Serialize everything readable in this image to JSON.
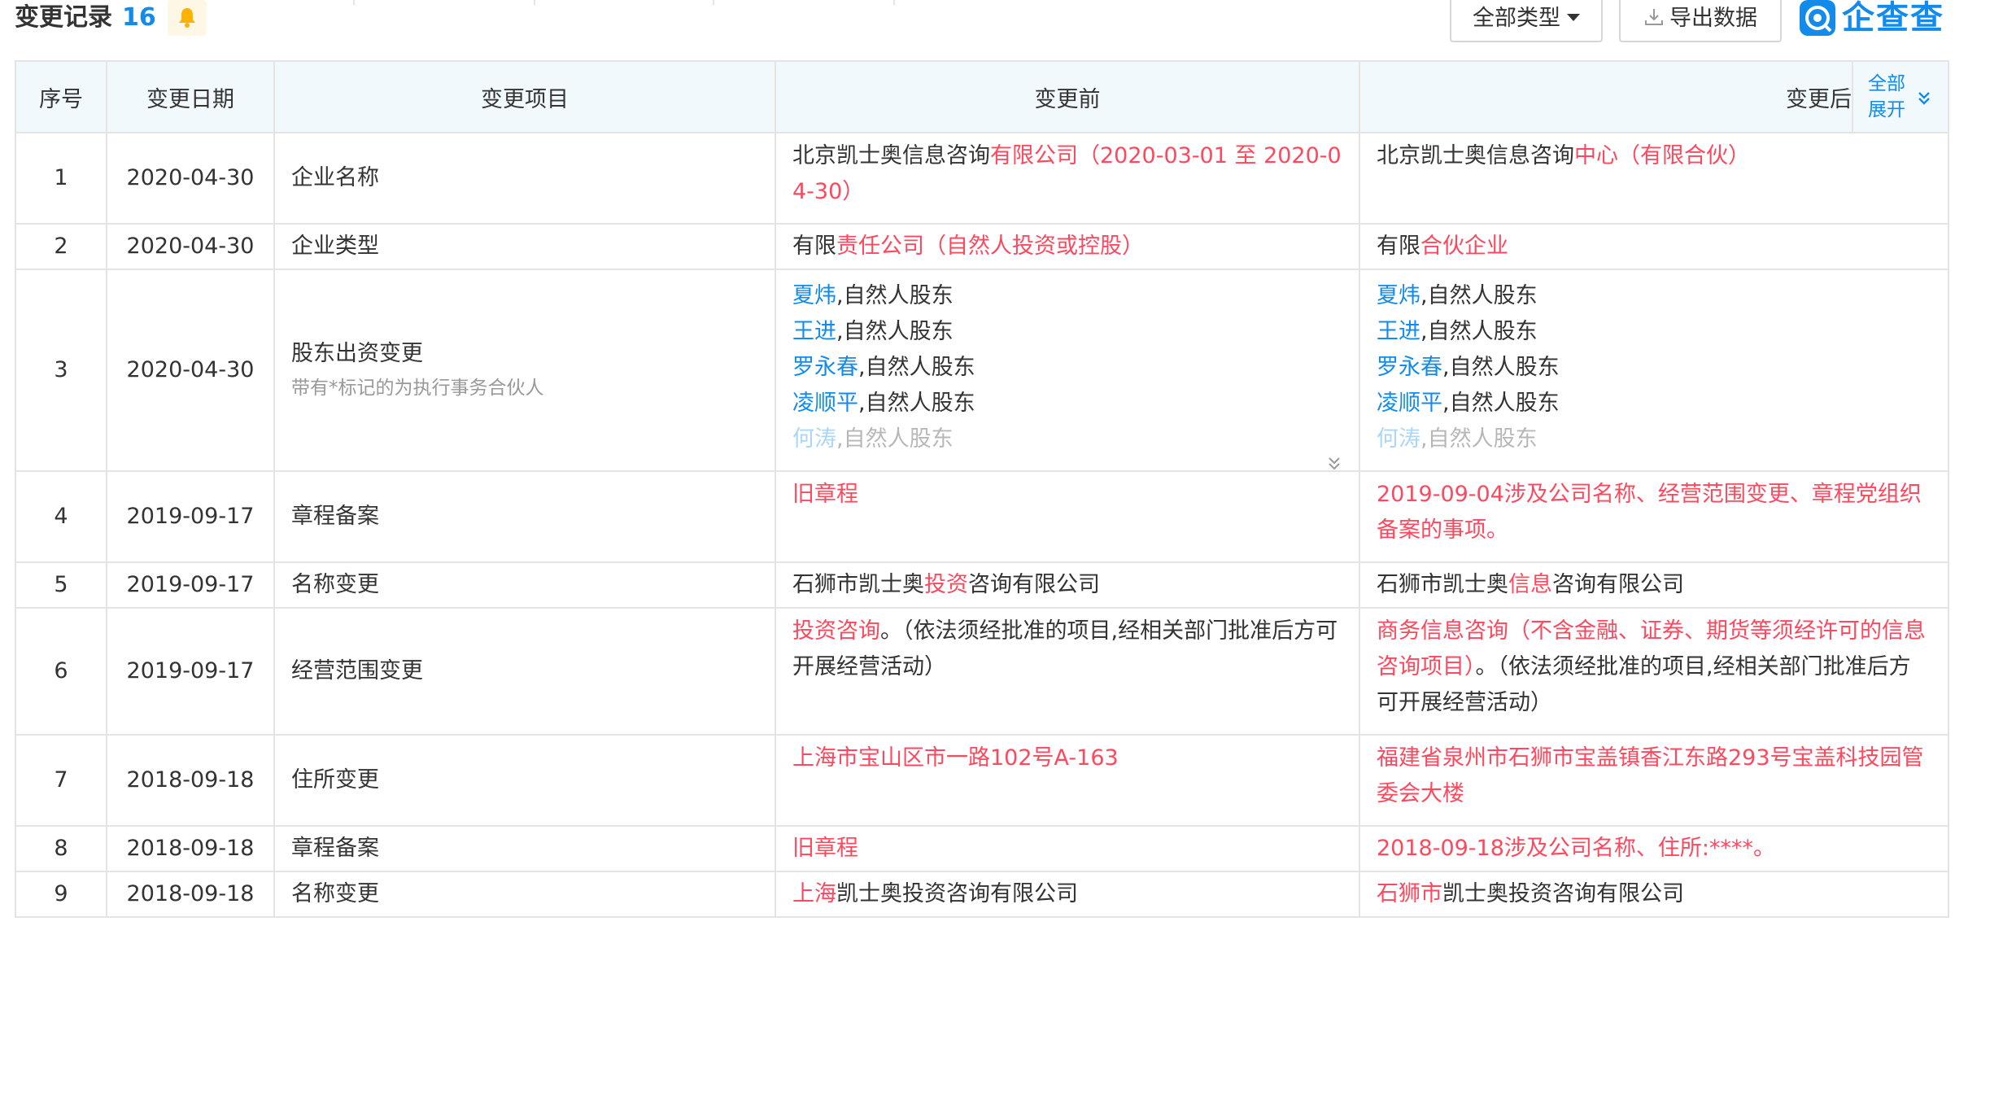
{
  "header": {
    "title": "变更记录",
    "count": "16",
    "type_filter_label": "全部类型",
    "export_label": "导出数据",
    "logo_text": "企查查",
    "accent_color": "#128bed",
    "highlight_color": "#fd485e"
  },
  "table": {
    "columns": [
      "序号",
      "变更日期",
      "变更项目",
      "变更前",
      "变更后"
    ],
    "expand_all_line1": "全部",
    "expand_all_line2": "展开",
    "rows": [
      {
        "no": "1",
        "date": "2020-04-30",
        "item": "企业名称",
        "before": [
          {
            "t": "北京凯士奥信息咨询"
          },
          {
            "t": "有限公司（2020-03-01 至 2020-04-30）",
            "hl": true
          }
        ],
        "after": [
          {
            "t": "北京凯士奥信息咨询"
          },
          {
            "t": "中心（有限合伙）",
            "hl": true
          }
        ]
      },
      {
        "no": "2",
        "date": "2020-04-30",
        "item": "企业类型",
        "before": [
          {
            "t": "有限"
          },
          {
            "t": "责任公司（自然人投资或控股）",
            "hl": true
          }
        ],
        "after": [
          {
            "t": "有限"
          },
          {
            "t": "合伙企业",
            "hl": true
          }
        ]
      },
      {
        "no": "3",
        "date": "2020-04-30",
        "item": "股东出资变更",
        "item_note": "带有*标记的为执行事务合伙人",
        "shareholders_before": [
          {
            "name": "夏炜",
            "role": ",自然人股东"
          },
          {
            "name": "王进",
            "role": ",自然人股东"
          },
          {
            "name": "罗永春",
            "role": ",自然人股东"
          },
          {
            "name": "凌顺平",
            "role": ",自然人股东"
          },
          {
            "name": "何涛",
            "role": ",自然人股东"
          }
        ],
        "shareholders_after": [
          {
            "name": "夏炜",
            "role": ",自然人股东"
          },
          {
            "name": "王进",
            "role": ",自然人股东"
          },
          {
            "name": "罗永春",
            "role": ",自然人股东"
          },
          {
            "name": "凌顺平",
            "role": ",自然人股东"
          },
          {
            "name": "何涛",
            "role": ",自然人股东"
          }
        ]
      },
      {
        "no": "4",
        "date": "2019-09-17",
        "item": "章程备案",
        "before": [
          {
            "t": "旧章程",
            "hl": true
          }
        ],
        "after": [
          {
            "t": "2019-09-04涉及公司名称、经营范围变更、章程党组织备案的事项。",
            "hl": true
          }
        ]
      },
      {
        "no": "5",
        "date": "2019-09-17",
        "item": "名称变更",
        "before": [
          {
            "t": "石狮市凯士奥"
          },
          {
            "t": "投资",
            "hl": true
          },
          {
            "t": "咨询有限公司"
          }
        ],
        "after": [
          {
            "t": "石狮市凯士奥"
          },
          {
            "t": "信息",
            "hl": true
          },
          {
            "t": "咨询有限公司"
          }
        ]
      },
      {
        "no": "6",
        "date": "2019-09-17",
        "item": "经营范围变更",
        "before": [
          {
            "t": "投资咨询",
            "hl": true
          },
          {
            "t": "。（依法须经批准的项目,经相关部门批准后方可开展经营活动）"
          }
        ],
        "after": [
          {
            "t": "商务信息咨询（不含金融、证券、期货等须经许可的信息咨询项目）",
            "hl": true
          },
          {
            "t": "。（依法须经批准的项目,经相关部门批准后方可开展经营活动）"
          }
        ]
      },
      {
        "no": "7",
        "date": "2018-09-18",
        "item": "住所变更",
        "before": [
          {
            "t": "上海市宝山区市一路102号A-163",
            "hl": true
          }
        ],
        "after": [
          {
            "t": "福建省泉州市石狮市宝盖镇香江东路293号宝盖科技园管委会大楼",
            "hl": true
          }
        ]
      },
      {
        "no": "8",
        "date": "2018-09-18",
        "item": "章程备案",
        "before": [
          {
            "t": "旧章程",
            "hl": true
          }
        ],
        "after": [
          {
            "t": "2018-09-18涉及公司名称、住所:****。",
            "hl": true
          }
        ]
      },
      {
        "no": "9",
        "date": "2018-09-18",
        "item": "名称变更",
        "before": [
          {
            "t": "上海",
            "hl": true
          },
          {
            "t": "凯士奥投资咨询有限公司"
          }
        ],
        "after": [
          {
            "t": "石狮市",
            "hl": true
          },
          {
            "t": "凯士奥投资咨询有限公司"
          }
        ]
      }
    ]
  }
}
